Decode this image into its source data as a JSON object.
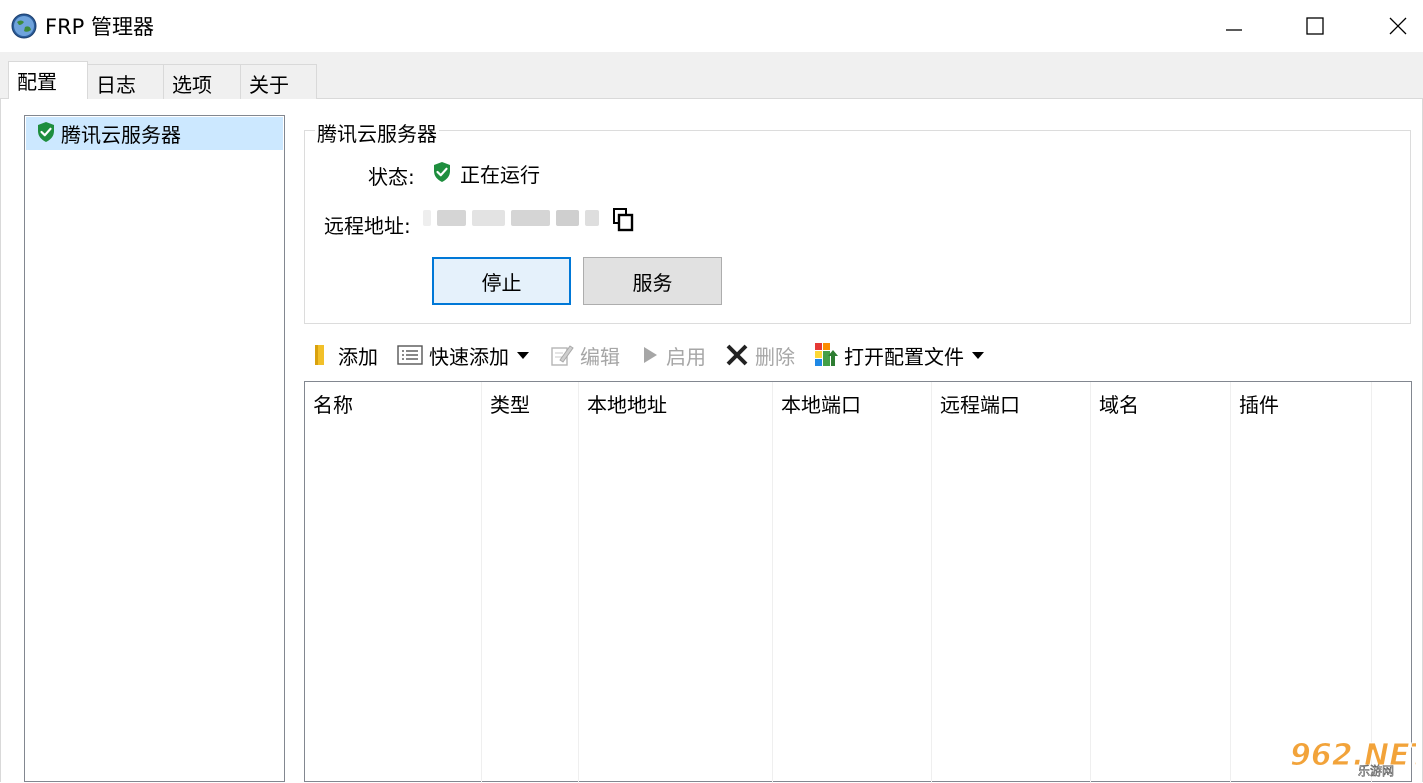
{
  "window": {
    "title": "FRP 管理器"
  },
  "tabs": [
    {
      "label": "配置",
      "active": true
    },
    {
      "label": "日志",
      "active": false
    },
    {
      "label": "选项",
      "active": false
    },
    {
      "label": "关于",
      "active": false
    }
  ],
  "server_list": {
    "items": [
      {
        "label": "腾讯云服务器",
        "status_icon": "shield-check-icon",
        "selected": true
      }
    ]
  },
  "details": {
    "group_title": "腾讯云服务器",
    "status_label": "状态:",
    "status_value": "正在运行",
    "remote_label": "远程地址:",
    "stop_button": "停止",
    "service_button": "服务"
  },
  "toolbar": {
    "add": "添加",
    "quick_add": "快速添加",
    "edit": "编辑",
    "enable": "启用",
    "delete": "删除",
    "open_config": "打开配置文件"
  },
  "table": {
    "columns": [
      "名称",
      "类型",
      "本地地址",
      "本地端口",
      "远程端口",
      "域名",
      "插件"
    ],
    "rows": []
  },
  "watermark": {
    "text": "962.NET",
    "subtext": "乐游网"
  },
  "colors": {
    "selection": "#cce8ff",
    "accent": "#0078d7",
    "running_green": "#1e8e3e"
  }
}
